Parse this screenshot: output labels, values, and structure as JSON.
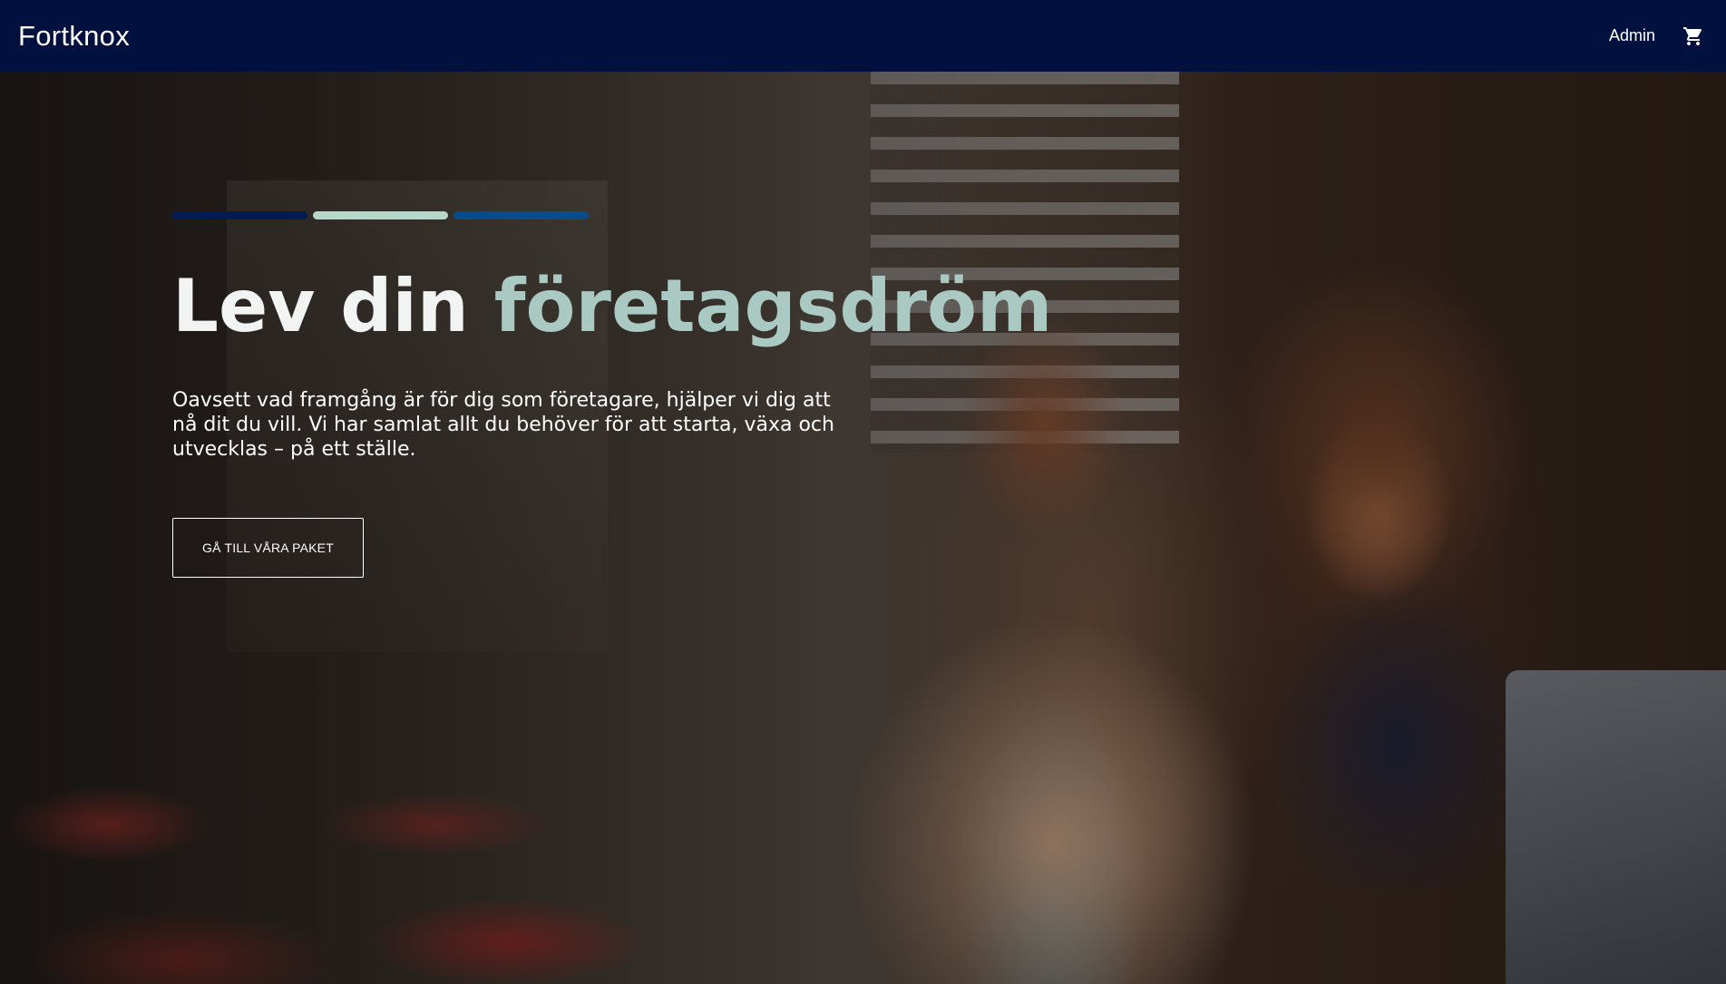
{
  "header": {
    "brand": "Fortknox",
    "admin_label": "Admin",
    "cart_icon": "shopping-cart-icon"
  },
  "hero": {
    "progress_bar_colors": [
      "#001a52",
      "#b7d6cc",
      "#0a4b8a"
    ],
    "headline_part1": "Lev din ",
    "headline_part2": "företagsdröm",
    "headline_part1_color": "#f2f4f4",
    "headline_part2_color": "#aac9c2",
    "description": "Oavsett vad framgång är för dig som företagare, hjälper vi dig att nå dit du vill. Vi har samlat allt du behöver för att starta, växa och utvecklas – på ett ställe.",
    "cta_label": "GÅ TILL VÅRA PAKET"
  },
  "colors": {
    "topbar": "#00113f"
  }
}
